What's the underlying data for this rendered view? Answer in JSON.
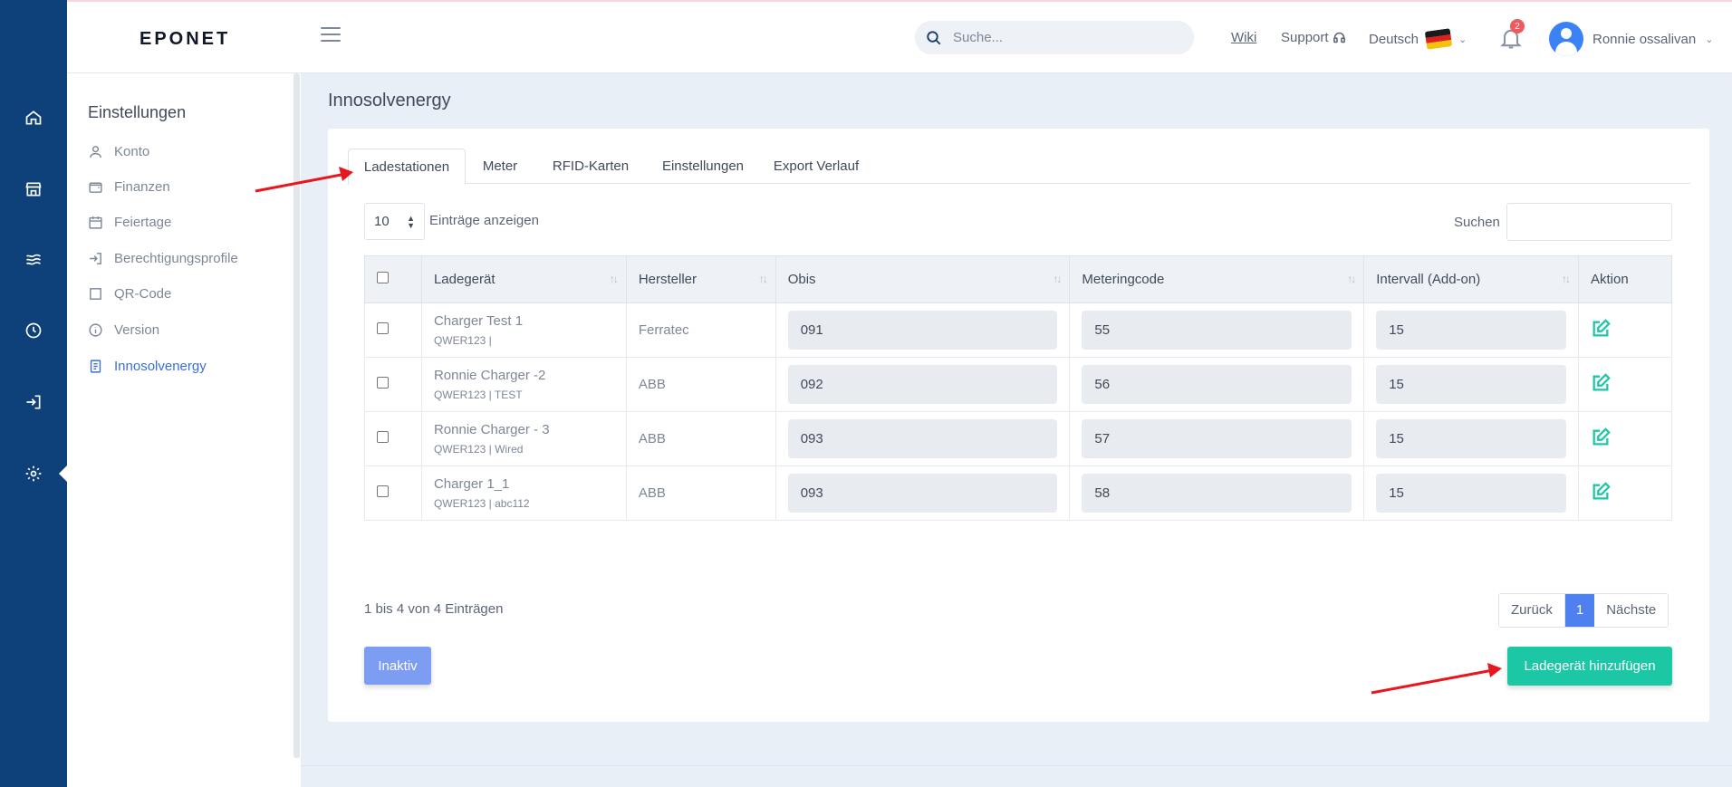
{
  "header": {
    "logo": "EPONET",
    "search_placeholder": "Suche...",
    "wiki": "Wiki",
    "support": "Support",
    "language": "Deutsch",
    "notification_count": "2",
    "user_name": "Ronnie ossalivan"
  },
  "sidebar": {
    "title": "Einstellungen",
    "items": [
      {
        "label": "Konto",
        "icon": "user-icon"
      },
      {
        "label": "Finanzen",
        "icon": "wallet-icon"
      },
      {
        "label": "Feiertage",
        "icon": "calendar-icon"
      },
      {
        "label": "Berechtigungsprofile",
        "icon": "login-icon"
      },
      {
        "label": "QR-Code",
        "icon": "square-icon"
      },
      {
        "label": "Version",
        "icon": "info-icon"
      },
      {
        "label": "Innosolvenergy",
        "icon": "document-icon",
        "active": true
      }
    ]
  },
  "page": {
    "title": "Innosolvenergy",
    "tabs": [
      "Ladestationen",
      "Meter",
      "RFID-Karten",
      "Einstellungen",
      "Export Verlauf"
    ],
    "active_tab": "Ladestationen",
    "entries_value": "10",
    "entries_label": "Einträge anzeigen",
    "search_label": "Suchen"
  },
  "table": {
    "columns": [
      "Ladegerät",
      "Hersteller",
      "Obis",
      "Meteringcode",
      "Intervall (Add-on)",
      "Aktion"
    ],
    "rows": [
      {
        "name": "Charger Test 1",
        "sub": "QWER123 |",
        "manufacturer": "Ferratec",
        "obis": "091",
        "metering": "55",
        "interval": "15"
      },
      {
        "name": "Ronnie Charger -2",
        "sub": "QWER123 | TEST",
        "manufacturer": "ABB",
        "obis": "092",
        "metering": "56",
        "interval": "15"
      },
      {
        "name": "Ronnie Charger - 3",
        "sub": "QWER123 | Wired",
        "manufacturer": "ABB",
        "obis": "093",
        "metering": "57",
        "interval": "15"
      },
      {
        "name": "Charger 1_1",
        "sub": "QWER123 | abc112",
        "manufacturer": "ABB",
        "obis": "093",
        "metering": "58",
        "interval": "15"
      }
    ]
  },
  "footer": {
    "info": "1 bis 4 von 4 Einträgen",
    "prev": "Zurück",
    "current_page": "1",
    "next": "Nächste",
    "inactive_button": "Inaktiv",
    "add_button": "Ladegerät hinzufügen"
  },
  "colors": {
    "rail": "#0e4079",
    "accent": "#4f80f0",
    "success": "#1cc7a6",
    "annotation_arrow": "#e8161d"
  }
}
